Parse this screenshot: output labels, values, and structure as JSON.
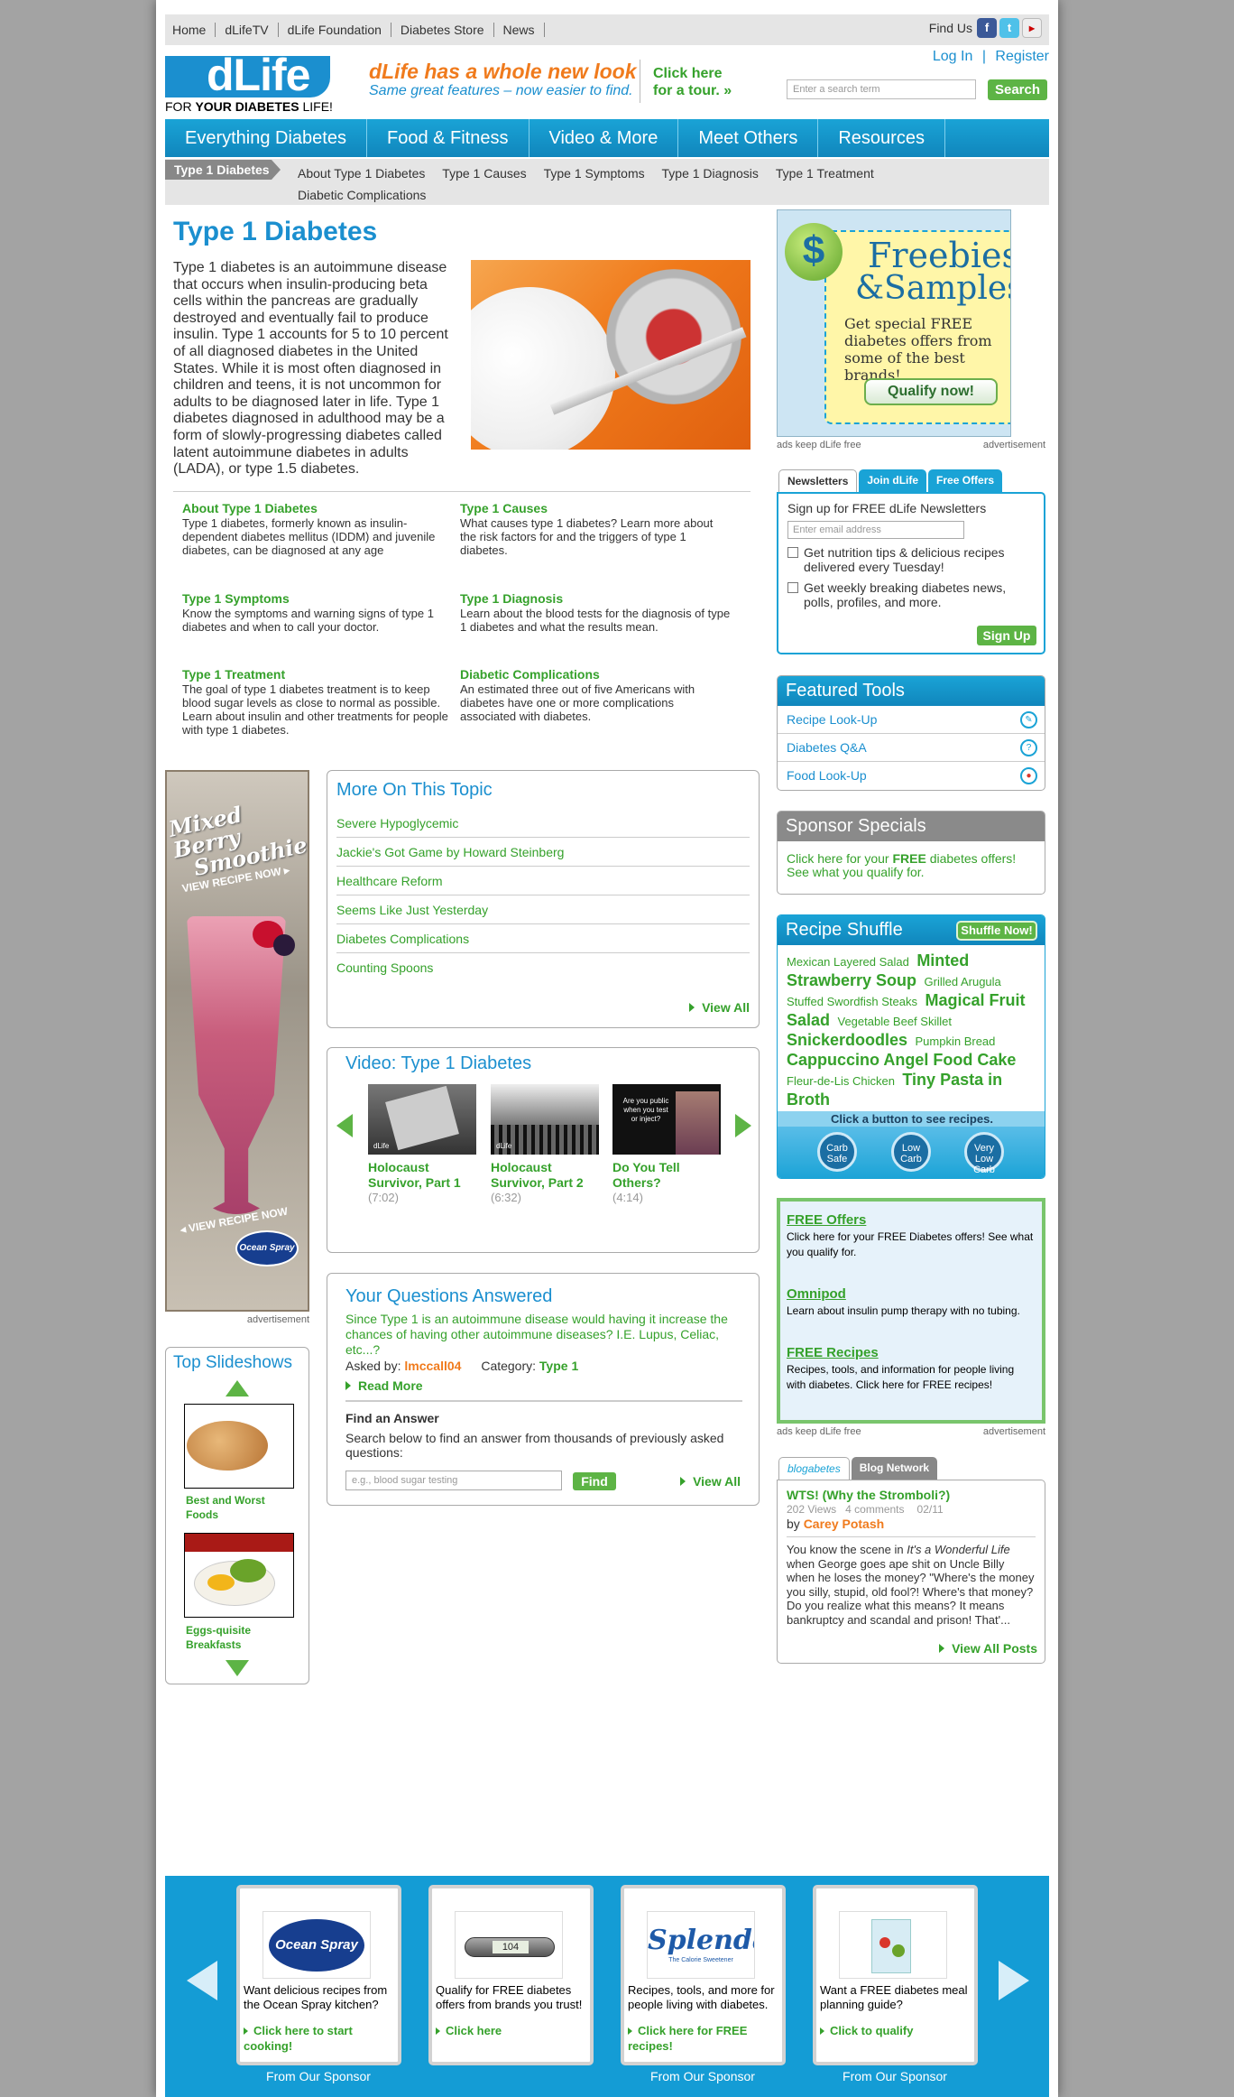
{
  "topnav": {
    "items": [
      "Home",
      "dLifeTV",
      "dLife Foundation",
      "Diabetes Store",
      "News"
    ],
    "find_us": "Find Us"
  },
  "header": {
    "logo": "dLife",
    "tagline_pre": "FOR ",
    "tagline_bold": "YOUR DIABETES",
    "tagline_post": " LIFE!",
    "promo_title": "dLife has a whole new look",
    "promo_sub": "Same great features – now easier to find.",
    "tour_line1": "Click here",
    "tour_line2": "for a tour. »",
    "login": "Log In",
    "register": "Register",
    "search_placeholder": "Enter a search term",
    "search_button": "Search"
  },
  "mainnav": [
    "Everything Diabetes",
    "Food & Fitness",
    "Video & More",
    "Meet Others",
    "Resources"
  ],
  "subnav": {
    "current": "Type 1 Diabetes",
    "items": [
      "About Type 1 Diabetes",
      "Type 1 Causes",
      "Type 1 Symptoms",
      "Type 1 Diagnosis",
      "Type 1 Treatment",
      "Diabetic Complications"
    ]
  },
  "article": {
    "title": "Type 1 Diabetes",
    "intro": "Type 1 diabetes is an autoimmune disease that occurs when insulin-producing beta cells within the pancreas are gradually destroyed and eventually fail to produce insulin. Type 1 accounts for 5 to 10 percent of all diagnosed diabetes in the United States. While it is most often diagnosed in children and teens, it is not uncommon for adults to be diagnosed later in life. Type 1 diabetes diagnosed in adulthood may be a form of slowly-progressing diabetes called latent autoimmune diabetes in adults (LADA), or type 1.5 diabetes.",
    "tiles": [
      {
        "title": "About Type 1 Diabetes",
        "desc": "Type 1 diabetes, formerly known as insulin-dependent diabetes mellitus (IDDM) and juvenile diabetes, can be diagnosed at any age"
      },
      {
        "title": "Type 1 Causes",
        "desc": "What causes type 1 diabetes? Learn more about the risk factors for and the triggers of type 1 diabetes."
      },
      {
        "title": "Type 1 Symptoms",
        "desc": "Know the symptoms and warning signs of type 1 diabetes and when to call your doctor."
      },
      {
        "title": "Type 1 Diagnosis",
        "desc": "Learn about the blood tests for the diagnosis of type 1 diabetes and what the results mean."
      },
      {
        "title": "Type 1 Treatment",
        "desc": "The goal of type 1 diabetes treatment is to keep blood sugar levels as close to normal as possible. Learn about insulin and other treatments for people with type 1 diabetes."
      },
      {
        "title": "Diabetic Complications",
        "desc": "An estimated three out of five Americans with diabetes have one or more complications associated with diabetes."
      }
    ]
  },
  "left_ad": {
    "line1": "Mixed Berry",
    "line2": "Smoothie",
    "cta": "VIEW RECIPE NOW ▸",
    "cta2": "◂ VIEW RECIPE NOW",
    "brand": "Ocean Spray",
    "label": "advertisement"
  },
  "slideshows": {
    "title": "Top Slideshows",
    "items": [
      "Best and Worst Foods",
      "Eggs-quisite Breakfasts"
    ]
  },
  "more_on_topic": {
    "title": "More On This Topic",
    "items": [
      "Severe Hypoglycemic",
      "Jackie's Got Game by Howard Steinberg",
      "Healthcare Reform",
      "Seems Like Just Yesterday",
      "Diabetes Complications",
      "Counting Spoons"
    ],
    "view_all": "View All"
  },
  "video": {
    "title": "Video: Type 1 Diabetes",
    "items": [
      {
        "title": "Holocaust Survivor, Part 1",
        "duration": "(7:02)"
      },
      {
        "title": "Holocaust Survivor, Part 2",
        "duration": "(6:32)"
      },
      {
        "title": "Do You Tell Others?",
        "duration": "(4:14)",
        "overlay": "Are you public when you test or inject?"
      }
    ],
    "thumb_logo": "dLife"
  },
  "questions": {
    "title": "Your Questions Answered",
    "question": "Since Type 1 is an autoimmune disease would having it increase the chances of having other autoimmune diseases? I.E. Lupus, Celiac, etc...?",
    "asked_by_label": "Asked by:",
    "asked_by": "lmccall04",
    "category_label": "Category:",
    "category": "Type 1",
    "read_more": "Read More",
    "find_title": "Find an Answer",
    "find_desc": "Search below to find an answer from thousands of previously asked questions:",
    "find_placeholder": "e.g., blood sugar testing",
    "find_button": "Find",
    "view_all": "View All"
  },
  "freebies": {
    "title1": "Freebies",
    "title2": "&Samples",
    "text": "Get special FREE diabetes offers from some of the best brands!",
    "button": "Qualify now!",
    "footer_left": "ads keep dLife free",
    "footer_right": "advertisement"
  },
  "newsletter": {
    "tabs": [
      "Newsletters",
      "Join dLife",
      "Free Offers"
    ],
    "title": "Sign up for FREE dLife Newsletters",
    "placeholder": "Enter email address",
    "options": [
      "Get nutrition tips & delicious recipes delivered every Tuesday!",
      "Get weekly breaking diabetes news, polls, profiles, and more."
    ],
    "button": "Sign Up"
  },
  "featured_tools": {
    "title": "Featured Tools",
    "items": [
      "Recipe Look-Up",
      "Diabetes Q&A",
      "Food Look-Up"
    ]
  },
  "sponsor_specials": {
    "title": "Sponsor Specials",
    "pre": "Click here for your ",
    "bold": "FREE",
    "post": " diabetes offers! See what you qualify for."
  },
  "recipe_shuffle": {
    "title": "Recipe Shuffle",
    "button": "Shuffle Now!",
    "recipes": [
      {
        "name": "Mexican Layered Salad",
        "size": "sm"
      },
      {
        "name": "Minted Strawberry Soup",
        "size": "lg"
      },
      {
        "name": "Grilled Arugula Stuffed Swordfish Steaks",
        "size": "sm"
      },
      {
        "name": "Magical Fruit Salad",
        "size": "lg"
      },
      {
        "name": "Vegetable Beef Skillet",
        "size": "sm"
      },
      {
        "name": "Snickerdoodles",
        "size": "lg"
      },
      {
        "name": "Pumpkin Bread",
        "size": "sm"
      },
      {
        "name": "Cappuccino Angel Food Cake",
        "size": "lg"
      },
      {
        "name": "Fleur-de-Lis Chicken",
        "size": "sm"
      },
      {
        "name": "Tiny Pasta in Broth",
        "size": "lg"
      }
    ],
    "prompt": "Click a button to see recipes.",
    "buttons": [
      "Carb Safe",
      "Low Carb",
      "Very Low Carb"
    ]
  },
  "offers": {
    "items": [
      {
        "title": "FREE Offers",
        "desc": "Click here for your FREE Diabetes offers! See what you qualify for."
      },
      {
        "title": "Omnipod",
        "desc": "Learn about insulin pump therapy with no tubing."
      },
      {
        "title": "FREE Recipes",
        "desc": "Recipes, tools, and information for people living with diabetes. Click here for FREE recipes!"
      }
    ],
    "footer_left": "ads keep dLife free",
    "footer_right": "advertisement"
  },
  "blog": {
    "tabs": [
      "blogabetes",
      "Blog Network"
    ],
    "title": "WTS! (Why the Stromboli?)",
    "views": "202 Views",
    "comments": "4 comments",
    "date": "02/11",
    "by_label": "by",
    "author": "Carey Potash",
    "excerpt_pre": "You know the scene in ",
    "excerpt_italic": "It's a Wonderful Life",
    "excerpt_post": " when George goes ape shit on Uncle Billy when he loses the money? \"Where's the money you silly, stupid, old fool?! Where's that money? Do you realize what this means? It means bankruptcy and scandal and prison! That'...",
    "view_all": "View All Posts"
  },
  "footer": {
    "sponsors": [
      {
        "logo": "Ocean Spray",
        "text": "Want delicious recipes from the Ocean Spray kitchen?",
        "link": "Click here to start cooking!"
      },
      {
        "logo": "104",
        "text": "Qualify for FREE diabetes offers from brands you trust!",
        "link": "Click here"
      },
      {
        "logo": "Splenda",
        "logo_sub": "The Calorie Sweetener",
        "text": "Recipes, tools, and more for people living with diabetes.",
        "link": "Click here for FREE recipes!"
      },
      {
        "logo": "",
        "text": "Want a FREE diabetes meal planning guide?",
        "link": "Click to qualify"
      }
    ],
    "label": "From Our Sponsor"
  },
  "colors": {
    "blue": "#1b8fcf",
    "green": "#35a12b",
    "orange": "#f07b1d",
    "nav_blue": "#1aa3d6"
  }
}
